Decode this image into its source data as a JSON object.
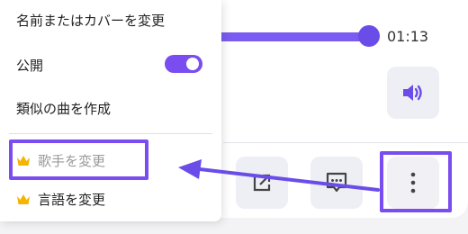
{
  "player": {
    "progress": 1.0,
    "time_label": "01:13"
  },
  "menu": {
    "rename_label": "名前またはカバーを変更",
    "public_label": "公開",
    "public_enabled": true,
    "similar_label": "類似の曲を作成",
    "change_artist_label": "歌手を変更",
    "change_language_label": "言語を変更"
  },
  "icons": {
    "volume": "speaker-icon",
    "share": "share-external-icon",
    "comment": "comment-bubble-icon",
    "more": "more-vertical-icon",
    "premium": "crown-icon"
  },
  "colors": {
    "accent": "#7a4df0",
    "crown": "#f5b400",
    "disabled_text": "#9a9a9a"
  }
}
